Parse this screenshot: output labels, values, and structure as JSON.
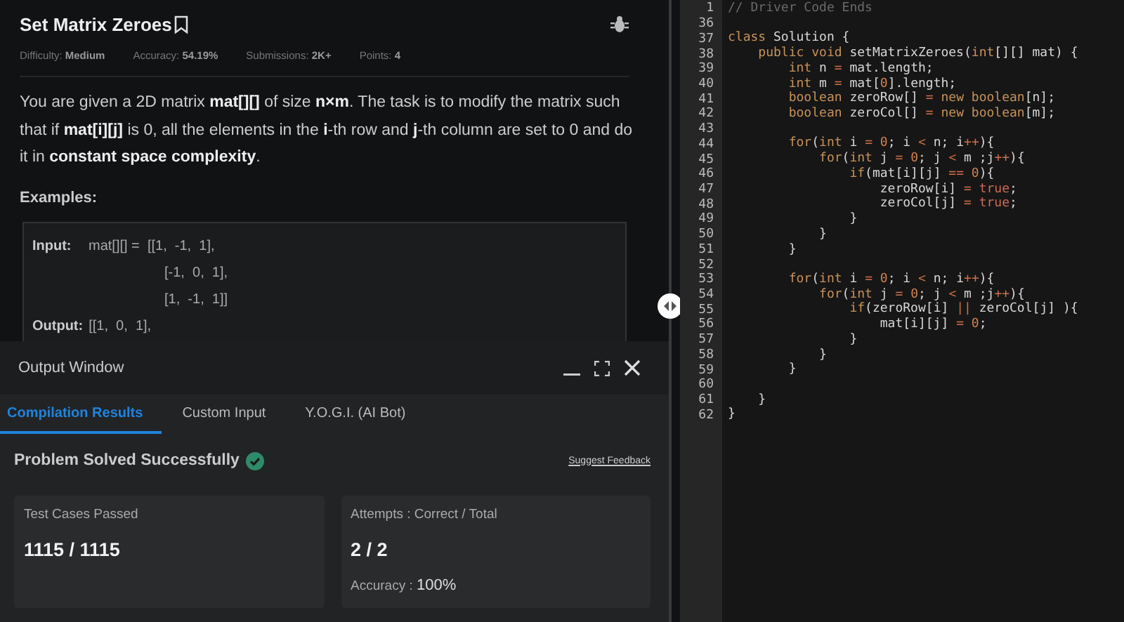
{
  "problem": {
    "title": "Set Matrix Zeroes",
    "meta": [
      {
        "label": "Difficulty:",
        "value": "Medium"
      },
      {
        "label": "Accuracy:",
        "value": "54.19%"
      },
      {
        "label": "Submissions:",
        "value": "2K+"
      },
      {
        "label": "Points:",
        "value": "4"
      }
    ],
    "statement": "You are given a 2D matrix **mat[][]** of size **n×m**. The task is to modify the matrix such that if **mat[i][j]** is 0, all the elements in the **i**-th row and **j**-th column are set to 0 and do it in **constant space complexity**.",
    "examples_heading": "Examples:",
    "example_lines": [
      {
        "label": "Input:",
        "text": "mat[][] =  [[1,  -1,  1],"
      },
      {
        "text": "[-1,  0,  1],"
      },
      {
        "text": "[1,  -1,  1]]"
      },
      {
        "label": "Output:",
        "text": "[[1,  0,  1],"
      }
    ]
  },
  "output_window": {
    "title": "Output Window",
    "tabs": [
      {
        "label": "Compilation Results",
        "selected": true
      },
      {
        "label": "Custom Input",
        "selected": false
      },
      {
        "label": "Y.O.G.I. (AI Bot)",
        "selected": false
      }
    ],
    "status": "Problem Solved Successfully",
    "feedback_link": "Suggest Feedback",
    "cards": [
      {
        "title": "Test Cases Passed",
        "value": "1115 / 1115"
      },
      {
        "title": "Attempts : Correct / Total",
        "value": "2 / 2",
        "accuracy_label": "Accuracy :",
        "accuracy_value": "100%"
      }
    ]
  },
  "editor": {
    "lines": [
      {
        "n": "1",
        "tokens": [
          {
            "t": "// Driver Code Ends",
            "kind": "faded"
          }
        ]
      },
      {
        "n": "36"
      },
      {
        "n": "37",
        "tokens": [
          {
            "t": "class",
            "kind": "kw"
          },
          {
            "t": " Solution {",
            "kind": "plain"
          }
        ]
      },
      {
        "n": "38",
        "tokens": [
          {
            "t": "    public void",
            "kind": "kw"
          },
          {
            "t": " setMatrixZeroes(",
            "kind": "plain"
          },
          {
            "t": "int",
            "kind": "kw"
          },
          {
            "t": "[][] mat) {",
            "kind": "plain"
          }
        ]
      },
      {
        "n": "39",
        "tokens": [
          {
            "t": "        int",
            "kind": "kw"
          },
          {
            "t": " n ",
            "kind": "plain"
          },
          {
            "t": "=",
            "kind": "op"
          },
          {
            "t": " mat.length;",
            "kind": "plain"
          }
        ]
      },
      {
        "n": "40",
        "tokens": [
          {
            "t": "        int",
            "kind": "kw"
          },
          {
            "t": " m ",
            "kind": "plain"
          },
          {
            "t": "=",
            "kind": "op"
          },
          {
            "t": " mat[",
            "kind": "plain"
          },
          {
            "t": "0",
            "kind": "num"
          },
          {
            "t": "].length;",
            "kind": "plain"
          }
        ]
      },
      {
        "n": "41",
        "tokens": [
          {
            "t": "        boolean",
            "kind": "kw"
          },
          {
            "t": " zeroRow[] ",
            "kind": "plain"
          },
          {
            "t": "=",
            "kind": "op"
          },
          {
            "t": " new boolean",
            "kind": "kw"
          },
          {
            "t": "[n];",
            "kind": "plain"
          }
        ]
      },
      {
        "n": "42",
        "tokens": [
          {
            "t": "        boolean",
            "kind": "kw"
          },
          {
            "t": " zeroCol[] ",
            "kind": "plain"
          },
          {
            "t": "=",
            "kind": "op"
          },
          {
            "t": " new boolean",
            "kind": "kw"
          },
          {
            "t": "[m];",
            "kind": "plain"
          }
        ]
      },
      {
        "n": "43"
      },
      {
        "n": "44",
        "tokens": [
          {
            "t": "        for",
            "kind": "kw"
          },
          {
            "t": "(",
            "kind": "plain"
          },
          {
            "t": "int",
            "kind": "kw"
          },
          {
            "t": " i ",
            "kind": "plain"
          },
          {
            "t": "= ",
            "kind": "op"
          },
          {
            "t": "0",
            "kind": "num"
          },
          {
            "t": "; i ",
            "kind": "plain"
          },
          {
            "t": "<",
            "kind": "op"
          },
          {
            "t": " n; i",
            "kind": "plain"
          },
          {
            "t": "++",
            "kind": "op"
          },
          {
            "t": "){",
            "kind": "plain"
          }
        ]
      },
      {
        "n": "45",
        "tokens": [
          {
            "t": "            for",
            "kind": "kw"
          },
          {
            "t": "(",
            "kind": "plain"
          },
          {
            "t": "int",
            "kind": "kw"
          },
          {
            "t": " j ",
            "kind": "plain"
          },
          {
            "t": "= ",
            "kind": "op"
          },
          {
            "t": "0",
            "kind": "num"
          },
          {
            "t": "; j ",
            "kind": "plain"
          },
          {
            "t": "<",
            "kind": "op"
          },
          {
            "t": " m ;j",
            "kind": "plain"
          },
          {
            "t": "++",
            "kind": "op"
          },
          {
            "t": "){",
            "kind": "plain"
          }
        ]
      },
      {
        "n": "46",
        "tokens": [
          {
            "t": "                if",
            "kind": "kw"
          },
          {
            "t": "(mat[i][j] ",
            "kind": "plain"
          },
          {
            "t": "== ",
            "kind": "op"
          },
          {
            "t": "0",
            "kind": "num"
          },
          {
            "t": "){",
            "kind": "plain"
          }
        ]
      },
      {
        "n": "47",
        "tokens": [
          {
            "t": "                    zeroRow[i] ",
            "kind": "plain"
          },
          {
            "t": "=",
            "kind": "op"
          },
          {
            "t": " true",
            "kind": "bool"
          },
          {
            "t": ";",
            "kind": "plain"
          }
        ]
      },
      {
        "n": "48",
        "tokens": [
          {
            "t": "                    zeroCol[j] ",
            "kind": "plain"
          },
          {
            "t": "=",
            "kind": "op"
          },
          {
            "t": " true",
            "kind": "bool"
          },
          {
            "t": ";",
            "kind": "plain"
          }
        ]
      },
      {
        "n": "49",
        "tokens": [
          {
            "t": "                }",
            "kind": "plain"
          }
        ]
      },
      {
        "n": "50",
        "tokens": [
          {
            "t": "            }",
            "kind": "plain"
          }
        ]
      },
      {
        "n": "51",
        "tokens": [
          {
            "t": "        }",
            "kind": "plain"
          }
        ]
      },
      {
        "n": "52"
      },
      {
        "n": "53",
        "tokens": [
          {
            "t": "        for",
            "kind": "kw"
          },
          {
            "t": "(",
            "kind": "plain"
          },
          {
            "t": "int",
            "kind": "kw"
          },
          {
            "t": " i ",
            "kind": "plain"
          },
          {
            "t": "= ",
            "kind": "op"
          },
          {
            "t": "0",
            "kind": "num"
          },
          {
            "t": "; i ",
            "kind": "plain"
          },
          {
            "t": "<",
            "kind": "op"
          },
          {
            "t": " n; i",
            "kind": "plain"
          },
          {
            "t": "++",
            "kind": "op"
          },
          {
            "t": "){",
            "kind": "plain"
          }
        ]
      },
      {
        "n": "54",
        "tokens": [
          {
            "t": "            for",
            "kind": "kw"
          },
          {
            "t": "(",
            "kind": "plain"
          },
          {
            "t": "int",
            "kind": "kw"
          },
          {
            "t": " j ",
            "kind": "plain"
          },
          {
            "t": "= ",
            "kind": "op"
          },
          {
            "t": "0",
            "kind": "num"
          },
          {
            "t": "; j ",
            "kind": "plain"
          },
          {
            "t": "<",
            "kind": "op"
          },
          {
            "t": " m ;j",
            "kind": "plain"
          },
          {
            "t": "++",
            "kind": "op"
          },
          {
            "t": "){",
            "kind": "plain"
          }
        ]
      },
      {
        "n": "55",
        "tokens": [
          {
            "t": "                if",
            "kind": "kw"
          },
          {
            "t": "(zeroRow[i] ",
            "kind": "plain"
          },
          {
            "t": "||",
            "kind": "op"
          },
          {
            "t": " zeroCol[j] ){",
            "kind": "plain"
          }
        ]
      },
      {
        "n": "56",
        "tokens": [
          {
            "t": "                    mat[i][j] ",
            "kind": "plain"
          },
          {
            "t": "= ",
            "kind": "op"
          },
          {
            "t": "0",
            "kind": "num"
          },
          {
            "t": ";",
            "kind": "plain"
          }
        ]
      },
      {
        "n": "57",
        "tokens": [
          {
            "t": "                }",
            "kind": "plain"
          }
        ]
      },
      {
        "n": "58",
        "tokens": [
          {
            "t": "            }",
            "kind": "plain"
          }
        ]
      },
      {
        "n": "59",
        "tokens": [
          {
            "t": "        }",
            "kind": "plain"
          }
        ]
      },
      {
        "n": "60"
      },
      {
        "n": "61",
        "tokens": [
          {
            "t": "    }",
            "kind": "plain"
          }
        ]
      },
      {
        "n": "62",
        "tokens": [
          {
            "t": "}",
            "kind": "plain"
          }
        ]
      }
    ]
  }
}
